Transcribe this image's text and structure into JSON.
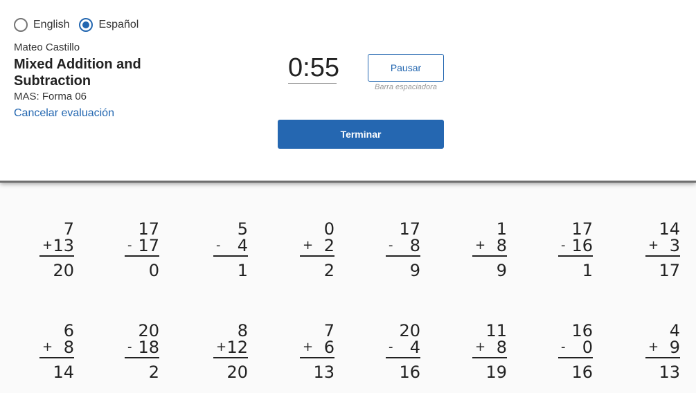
{
  "language": {
    "options": [
      {
        "label": "English",
        "selected": false
      },
      {
        "label": "Español",
        "selected": true
      }
    ]
  },
  "student_name": "Mateo Castillo",
  "assessment_title": "Mixed Addition and Subtraction",
  "form_label": "MAS: Forma 06",
  "cancel_label": "Cancelar evaluación",
  "timer": "0:55",
  "pause_label": "Pausar",
  "pause_hint": "Barra espaciadora",
  "finish_label": "Terminar",
  "accent_color": "#2266b0",
  "problems": [
    {
      "top": "7",
      "op": "+",
      "bottom": "13",
      "answer": "20"
    },
    {
      "top": "17",
      "op": "-",
      "bottom": "17",
      "answer": "0"
    },
    {
      "top": "5",
      "op": "-",
      "bottom": "4",
      "answer": "1"
    },
    {
      "top": "0",
      "op": "+",
      "bottom": "2",
      "answer": "2"
    },
    {
      "top": "17",
      "op": "-",
      "bottom": "8",
      "answer": "9"
    },
    {
      "top": "1",
      "op": "+",
      "bottom": "8",
      "answer": "9"
    },
    {
      "top": "17",
      "op": "-",
      "bottom": "16",
      "answer": "1"
    },
    {
      "top": "14",
      "op": "+",
      "bottom": "3",
      "answer": "17"
    },
    {
      "top": "6",
      "op": "+",
      "bottom": "8",
      "answer": "14"
    },
    {
      "top": "20",
      "op": "-",
      "bottom": "18",
      "answer": "2"
    },
    {
      "top": "8",
      "op": "+",
      "bottom": "12",
      "answer": "20"
    },
    {
      "top": "7",
      "op": "+",
      "bottom": "6",
      "answer": "13"
    },
    {
      "top": "20",
      "op": "-",
      "bottom": "4",
      "answer": "16"
    },
    {
      "top": "11",
      "op": "+",
      "bottom": "8",
      "answer": "19"
    },
    {
      "top": "16",
      "op": "-",
      "bottom": "0",
      "answer": "16"
    },
    {
      "top": "4",
      "op": "+",
      "bottom": "9",
      "answer": "13"
    }
  ]
}
